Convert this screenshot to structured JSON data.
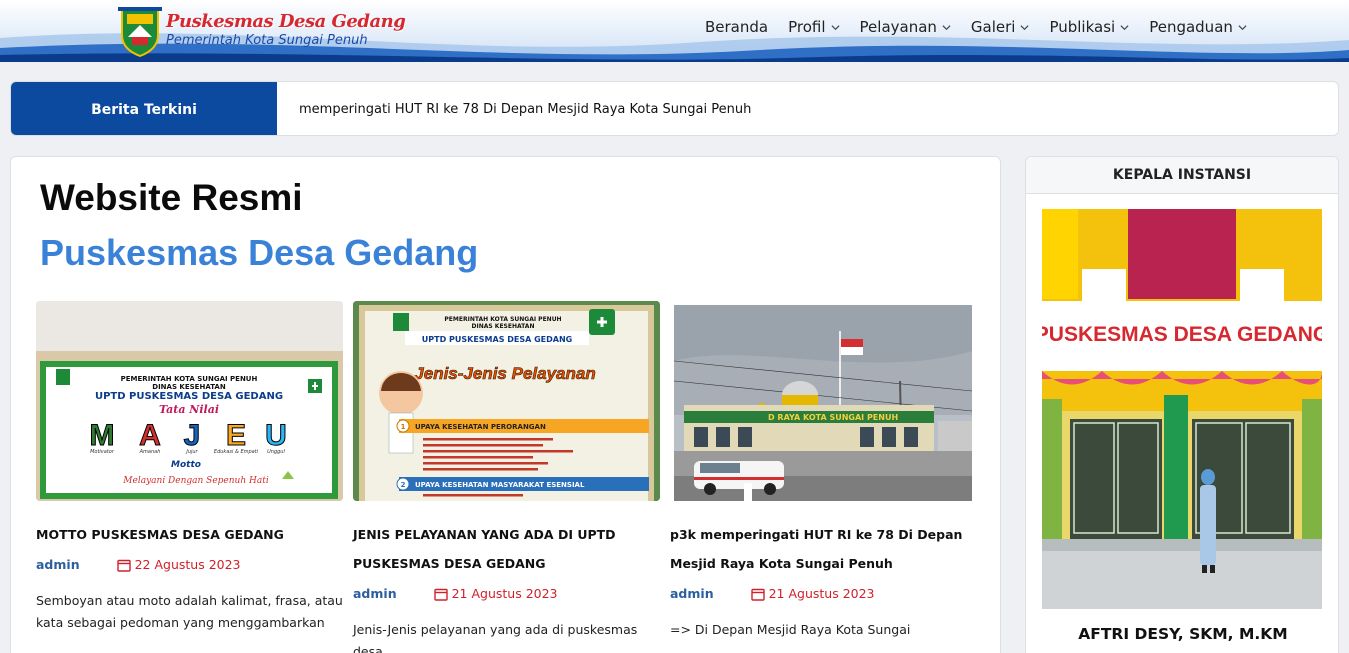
{
  "header": {
    "brand_title": "Puskesmas Desa Gedang",
    "brand_subtitle": "Pemerintah Kota Sungai Penuh",
    "nav": [
      {
        "label": "Beranda",
        "dropdown": false
      },
      {
        "label": "Profil",
        "dropdown": true
      },
      {
        "label": "Pelayanan",
        "dropdown": true
      },
      {
        "label": "Galeri",
        "dropdown": true
      },
      {
        "label": "Publikasi",
        "dropdown": true
      },
      {
        "label": "Pengaduan",
        "dropdown": true
      }
    ]
  },
  "ticker": {
    "label": "Berita Terkini",
    "text": "memperingati HUT RI ke 78 Di Depan Mesjid Raya Kota Sungai Penuh"
  },
  "main": {
    "title_line1": "Website Resmi",
    "title_line2": "Puskesmas Desa Gedang",
    "posts": [
      {
        "title": "MOTTO PUSKESMAS DESA GEDANG",
        "author": "admin",
        "date": "22 Agustus 2023",
        "excerpt": "Semboyan atau moto adalah kalimat, frasa, atau kata sebagai pedoman yang menggambarkan",
        "image": {
          "line1": "PEMERINTAH KOTA SUNGAI PENUH",
          "line2": "DINAS KESEHATAN",
          "line3": "UPTD PUSKESMAS DESA GEDANG",
          "line4": "Tata Nilai",
          "letters": [
            "M",
            "A",
            "J",
            "E",
            "U"
          ],
          "letter_words": [
            "Motivator",
            "Amanah",
            "Jujur",
            "Edukasi & Empati",
            "Unggul"
          ],
          "motto": "Motto",
          "tagline": "Melayani Dengan Sepenuh Hati"
        }
      },
      {
        "title": "JENIS PELAYANAN YANG ADA DI UPTD PUSKESMAS DESA GEDANG",
        "author": "admin",
        "date": "21 Agustus 2023",
        "excerpt": "Jenis-Jenis pelayanan yang ada di puskesmas desa",
        "image": {
          "line1": "PEMERINTAH KOTA SUNGAI PENUH",
          "line2": "DINAS KESEHATAN",
          "line3": "UPTD PUSKESMAS DESA GEDANG",
          "heading": "Jenis-Jenis Pelayanan",
          "section1": "UPAYA KESEHATAN PERORANGAN",
          "section2": "UPAYA KESEHATAN MASYARAKAT ESENSIAL",
          "num1": "1",
          "num2": "2"
        }
      },
      {
        "title": "p3k memperingati HUT RI ke 78 Di Depan Mesjid Raya Kota Sungai Penuh",
        "author": "admin",
        "date": "21 Agustus 2023",
        "excerpt": "=> Di Depan Mesjid Raya Kota Sungai",
        "image": {
          "sign": "D RAYA KOTA SUNGAI PENUH"
        }
      }
    ]
  },
  "sidebar": {
    "heading": "KEPALA INSTANSI",
    "photo_sign": "PUSKESMAS DESA GEDANG",
    "name": "AFTRI DESY, SKM, M.KM"
  },
  "colors": {
    "primary_blue": "#0b4a9e",
    "title_blue": "#3a82d8",
    "date_red": "#d2202a",
    "author_blue": "#2c5f9e"
  },
  "icons": [
    "chevron-down-icon",
    "calendar-icon",
    "crest-logo"
  ]
}
